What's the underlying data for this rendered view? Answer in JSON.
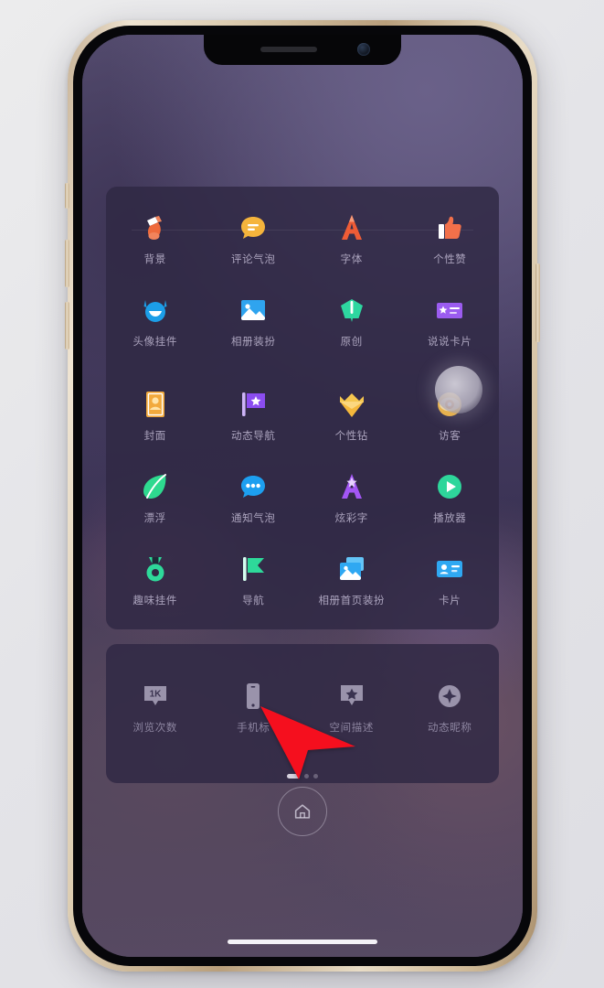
{
  "device": {
    "type": "smartphone-mockup",
    "frame_color": "#d7c4a4",
    "screen_bg": "#4a4166"
  },
  "wallpaper": {
    "accent_top": "#6a6189",
    "accent_bottom": "#574a63"
  },
  "panels": {
    "main": {
      "name": "decoration-store-grid",
      "bg": "#302844",
      "rows": [
        {
          "cells": [
            {
              "label": "背景",
              "icon": "paint-roller-icon",
              "enabled": true,
              "color": "#f0724a"
            },
            {
              "label": "评论气泡",
              "icon": "comment-bubble-icon",
              "enabled": true,
              "color": "#f5b43c"
            },
            {
              "label": "字体",
              "icon": "letter-a-font-icon",
              "enabled": true,
              "color": "#f0643c"
            },
            {
              "label": "个性赞",
              "icon": "thumbs-up-icon",
              "enabled": true,
              "color": "#f2704a"
            }
          ]
        },
        {
          "cells": [
            {
              "label": "头像挂件",
              "icon": "avatar-pendant-icon",
              "enabled": true,
              "color": "#1c9ee8"
            },
            {
              "label": "相册装扮",
              "icon": "photo-album-icon",
              "enabled": true,
              "color": "#2fa4ef"
            },
            {
              "label": "原创",
              "icon": "original-pen-icon",
              "enabled": true,
              "color": "#2ed6a0"
            },
            {
              "label": "说说卡片",
              "icon": "post-card-icon",
              "enabled": true,
              "color": "#9b5cf0"
            }
          ]
        },
        {
          "cells": [
            {
              "label": "封面",
              "icon": "cover-page-icon",
              "enabled": true,
              "color": "#f2a93c"
            },
            {
              "label": "动态导航",
              "icon": "feed-flag-icon",
              "enabled": true,
              "color": "#8b4df0"
            },
            {
              "label": "个性钻",
              "icon": "crown-diamond-icon",
              "enabled": true,
              "color": "#f5b83c"
            },
            {
              "label": "访客",
              "icon": "visitor-eye-icon",
              "enabled": true,
              "color": "#f2b43c"
            }
          ]
        },
        {
          "cells": [
            {
              "label": "漂浮",
              "icon": "floating-leaf-icon",
              "enabled": true,
              "color": "#2ed98f"
            },
            {
              "label": "通知气泡",
              "icon": "notification-bubble-icon",
              "enabled": true,
              "color": "#1d9ff0"
            },
            {
              "label": "炫彩字",
              "icon": "colorful-text-icon",
              "enabled": true,
              "color": "#a356f5"
            },
            {
              "label": "播放器",
              "icon": "music-player-icon",
              "enabled": true,
              "color": "#2ed69b"
            }
          ]
        },
        {
          "cells": [
            {
              "label": "趣味挂件",
              "icon": "fun-pendant-icon",
              "enabled": true,
              "color": "#2ed99a"
            },
            {
              "label": "导航",
              "icon": "navigation-flag-icon",
              "enabled": true,
              "color": "#2ed99a"
            },
            {
              "label": "相册首页装扮",
              "icon": "album-home-icon",
              "enabled": true,
              "color": "#2fa8f2"
            },
            {
              "label": "卡片",
              "icon": "card-icon",
              "enabled": true,
              "color": "#2fa8f2"
            }
          ]
        }
      ]
    },
    "bottom": {
      "name": "disabled-items-panel",
      "bg": "#302844",
      "rows": [
        {
          "cells": [
            {
              "label": "浏览次数",
              "icon": "view-count-icon",
              "enabled": false,
              "color": "#9a93ab"
            },
            {
              "label": "手机标",
              "icon": "phone-tag-icon",
              "enabled": false,
              "color": "#9a93ab"
            },
            {
              "label": "空间描述",
              "icon": "space-description-icon",
              "enabled": false,
              "color": "#9a93ab"
            },
            {
              "label": "动态昵称",
              "icon": "dynamic-nickname-icon",
              "enabled": false,
              "color": "#9a93ab"
            }
          ]
        }
      ]
    }
  },
  "overlays": {
    "touch_indicator": {
      "name": "touch-press-indicator",
      "color": "#b6b2c0"
    },
    "cursor": {
      "name": "mouse-cursor-arrow",
      "color": "#f50f1e"
    }
  },
  "page_indicator": {
    "pages": 2,
    "active": 1
  },
  "home_button": {
    "icon": "home-icon",
    "label": ""
  },
  "status_bar": {
    "speaker": "earpiece-speaker",
    "camera": "front-camera"
  }
}
